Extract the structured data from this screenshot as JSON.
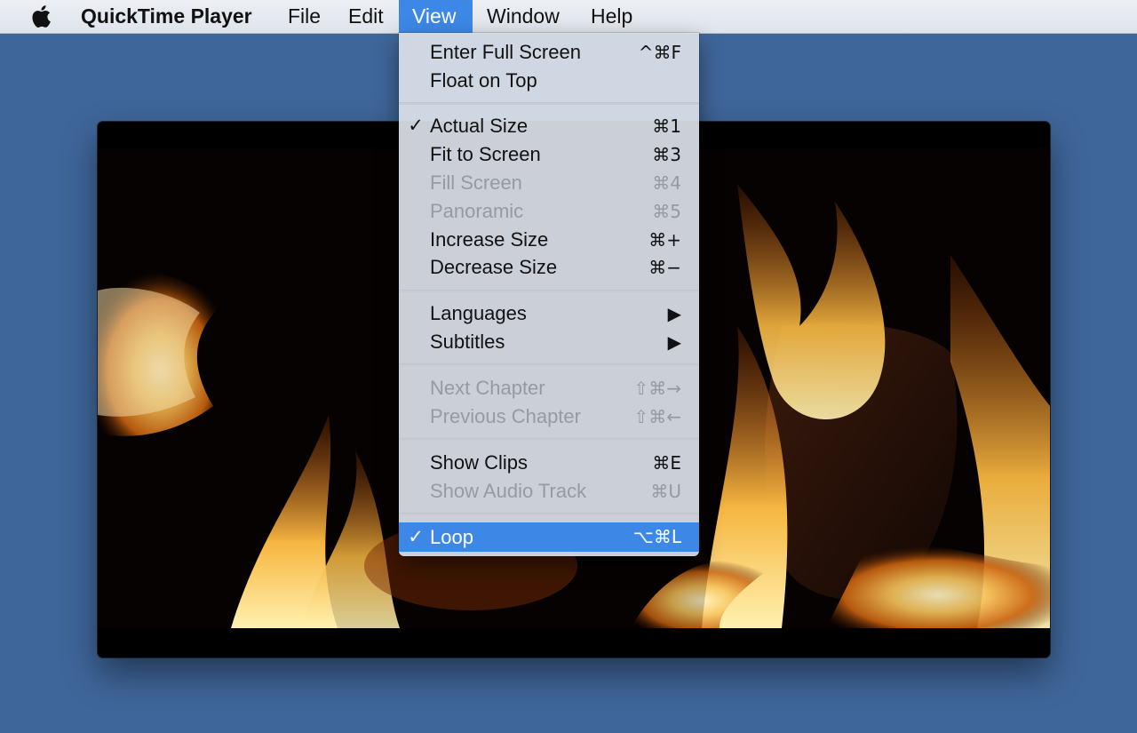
{
  "menubar": {
    "apple_icon": "apple-icon",
    "app_name": "QuickTime Player",
    "items": [
      "File",
      "Edit",
      "View",
      "Window",
      "Help"
    ]
  },
  "view_menu": {
    "accent": "#3d88e6",
    "items": [
      {
        "label": "Enter Full Screen",
        "shortcut": "^⌘F",
        "checked": false,
        "disabled": false
      },
      {
        "label": "Float on Top",
        "shortcut": "",
        "checked": false,
        "disabled": false
      },
      {
        "label": "Actual Size",
        "shortcut": "⌘1",
        "checked": true,
        "disabled": false
      },
      {
        "label": "Fit to Screen",
        "shortcut": "⌘3",
        "checked": false,
        "disabled": false
      },
      {
        "label": "Fill Screen",
        "shortcut": "⌘4",
        "checked": false,
        "disabled": true
      },
      {
        "label": "Panoramic",
        "shortcut": "⌘5",
        "checked": false,
        "disabled": true
      },
      {
        "label": "Increase Size",
        "shortcut": "⌘+",
        "checked": false,
        "disabled": false
      },
      {
        "label": "Decrease Size",
        "shortcut": "⌘−",
        "checked": false,
        "disabled": false
      },
      {
        "label": "Languages",
        "shortcut": "▶",
        "checked": false,
        "disabled": false
      },
      {
        "label": "Subtitles",
        "shortcut": "▶",
        "checked": false,
        "disabled": false
      },
      {
        "label": "Next Chapter",
        "shortcut": "⇧⌘→",
        "checked": false,
        "disabled": true
      },
      {
        "label": "Previous Chapter",
        "shortcut": "⇧⌘←",
        "checked": false,
        "disabled": true
      },
      {
        "label": "Show Clips",
        "shortcut": "⌘E",
        "checked": false,
        "disabled": false
      },
      {
        "label": "Show Audio Track",
        "shortcut": "⌘U",
        "checked": false,
        "disabled": true
      },
      {
        "label": "Loop",
        "shortcut": "⌥⌘L",
        "checked": true,
        "disabled": false,
        "highlighted": true
      }
    ]
  },
  "check_mark": "✓",
  "player": {
    "video_content": "fireplace-flames"
  }
}
